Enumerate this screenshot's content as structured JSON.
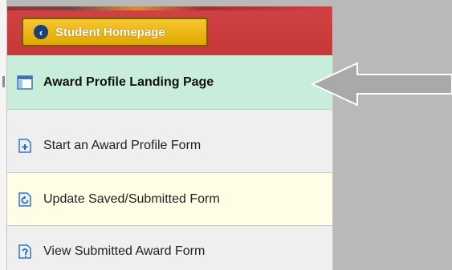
{
  "header": {
    "home_button_label": "Student Homepage",
    "back_icon": "chevron-left-icon"
  },
  "nav": {
    "items": [
      {
        "label": "Award Profile Landing Page",
        "icon": "page-layout-icon",
        "selected": true
      },
      {
        "label": "Start an Award Profile Form",
        "icon": "add-document-icon"
      },
      {
        "label": "Update Saved/Submitted Form",
        "icon": "refresh-document-icon"
      },
      {
        "label": "View Submitted Award Form",
        "icon": "view-document-icon"
      }
    ]
  },
  "colors": {
    "header_red": "#cf4243",
    "home_button_gold": "#f2bd1f",
    "selected_green": "#c9eddb",
    "highlight_yellow": "#fefee6"
  }
}
